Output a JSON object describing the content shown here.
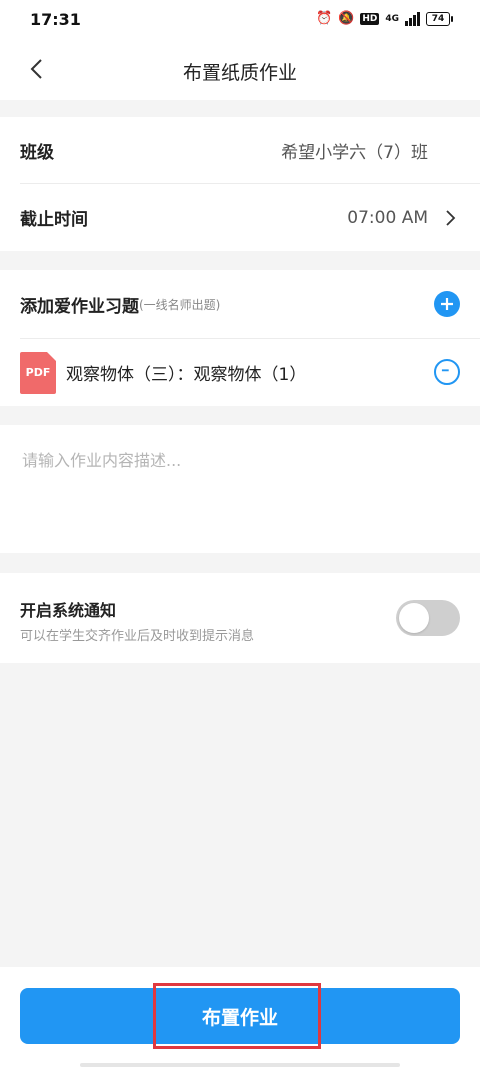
{
  "status_bar": {
    "time": "17:31",
    "hd_label": "HD",
    "network_label": "4G",
    "battery_level": "74"
  },
  "header": {
    "title": "布置纸质作业",
    "back_icon": "chevron-left-icon"
  },
  "form": {
    "class_label": "班级",
    "class_value": "希望小学六（7）班",
    "deadline_label": "截止时间",
    "deadline_value": "07:00 AM"
  },
  "exercises": {
    "title": "添加爱作业习题",
    "hint": "(一线名师出题)",
    "items": [
      {
        "file_type": "PDF",
        "name": "观察物体（三）：观察物体（1）"
      }
    ]
  },
  "description": {
    "placeholder": "请输入作业内容描述..."
  },
  "notification": {
    "title": "开启系统通知",
    "subtitle": "可以在学生交齐作业后及时收到提示消息",
    "enabled": false
  },
  "footer": {
    "submit_label": "布置作业"
  },
  "colors": {
    "accent": "#2196f3",
    "pdf_badge": "#f06a6a",
    "highlight_border": "#e0383f"
  }
}
